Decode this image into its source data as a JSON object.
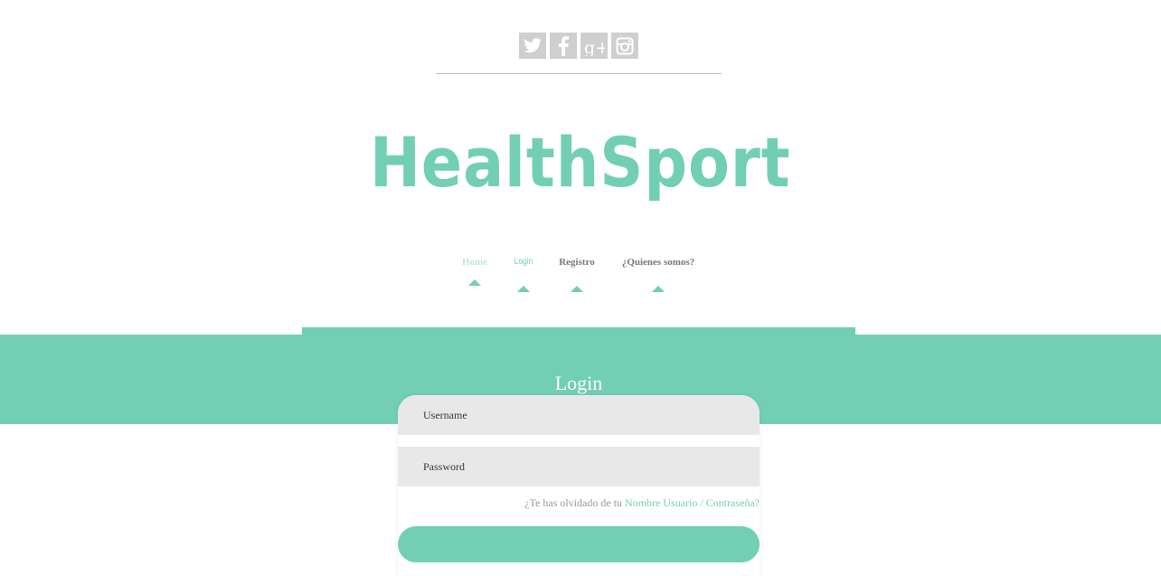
{
  "social": {
    "items": [
      {
        "name": "twitter",
        "icon": "twitter-icon"
      },
      {
        "name": "facebook",
        "icon": "facebook-icon"
      },
      {
        "name": "google-plus",
        "icon": "google-plus-icon"
      },
      {
        "name": "instagram",
        "icon": "instagram-icon"
      }
    ],
    "google_plus_glyph": "g+"
  },
  "brand": {
    "logo_text": "HealthSport",
    "accent_color": "#72cfb4"
  },
  "nav": {
    "home": "Home",
    "login": "Login",
    "registro": "Registro",
    "quienes": "¿Quienes somos?"
  },
  "login": {
    "title": "Login",
    "username_placeholder": "Username",
    "password_placeholder": "Password",
    "forgot_prefix": "¿Te has olvidado de tu ",
    "forgot_link": "Nombre Usuario / Contraseña?",
    "submit_label": ""
  }
}
